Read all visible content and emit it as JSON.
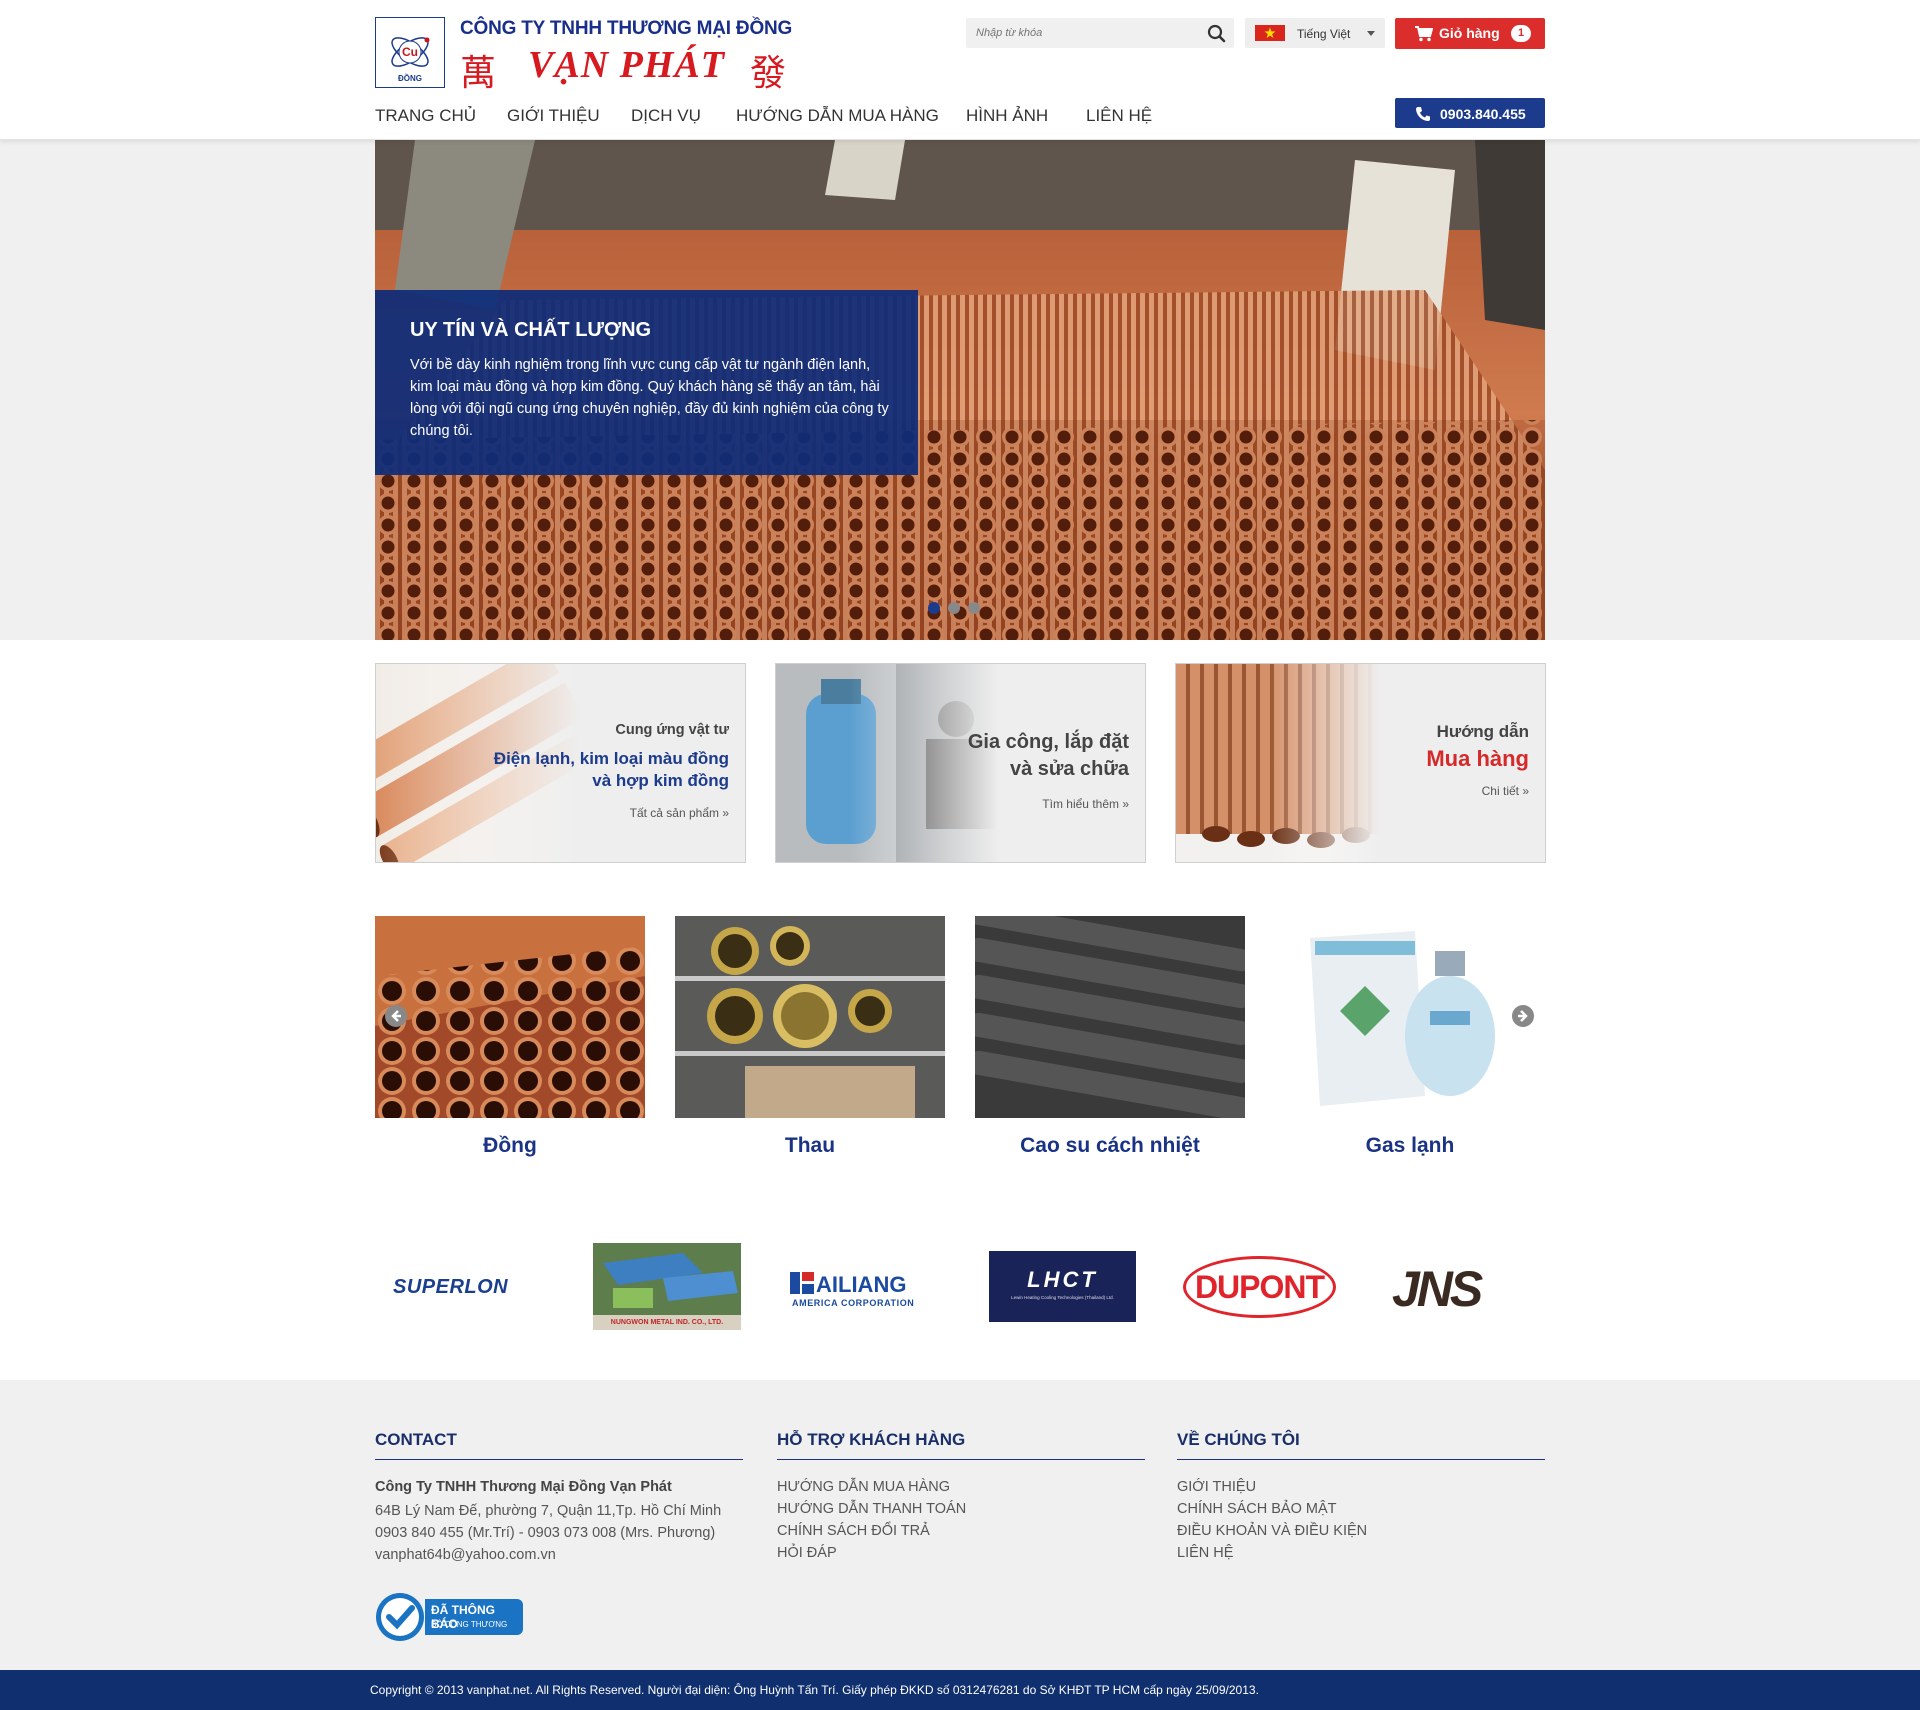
{
  "header": {
    "logo_cu": "Cu",
    "logo_dong": "ĐỒNG",
    "company_line1": "CÔNG TY TNHH THƯƠNG MẠI ĐỒNG",
    "company_name": "VẠN PHÁT",
    "han_left": "萬",
    "han_right": "發",
    "search_placeholder": "Nhập từ khóa",
    "language": "Tiếng Việt",
    "cart_label": "Giỏ hàng",
    "cart_count": "1",
    "hotline": "0903.840.455"
  },
  "nav": {
    "items": [
      "TRANG CHỦ",
      "GIỚI THIỆU",
      "DỊCH VỤ",
      "HƯỚNG DẪN MUA HÀNG",
      "HÌNH ẢNH",
      "LIÊN HỆ"
    ]
  },
  "hero": {
    "title": "UY TÍN VÀ CHẤT LƯỢNG",
    "description": "Với bề dày kinh nghiệm trong lĩnh vực cung cấp vật tư ngành điện lạnh, kim loại màu đồng và hợp kim đồng. Quý khách hàng sẽ thấy an tâm, hài lòng với đội ngũ cung ứng chuyên nghiệp, đầy đủ kinh nghiệm của công ty chúng tôi.",
    "slide_count": 3,
    "active_slide": 1
  },
  "features": [
    {
      "line1": "Cung ứng vật tư",
      "line2": "Điện lạnh,  kim loại màu đồng",
      "line3": "và hợp kim đồng",
      "link": "Tất cả sản phẩm »"
    },
    {
      "line1": "Gia công, lắp đặt",
      "line2": "và sửa chữa",
      "link": "Tìm hiểu thêm »"
    },
    {
      "line1": "Hướng dẫn",
      "line2": "Mua hàng",
      "link": "Chi tiết »"
    }
  ],
  "products": [
    "Đồng",
    "Thau",
    "Cao su cách nhiệt",
    "Gas lạnh"
  ],
  "partners": {
    "superlon": "SUPERLON",
    "nungwon": "NUNGWON METAL IND. CO., LTD.",
    "hailiang": "AILIANG",
    "hailiang_sub": "AMERICA CORPORATION",
    "lhct": "LHCT",
    "lhct_sub": "Lewin Heating Cooling Technologies (Thailand) Ltd.",
    "dupont": "DUPONT",
    "jns": "JNS"
  },
  "footer": {
    "contact": {
      "heading": "CONTACT",
      "company": "Công Ty TNHH Thương Mại Đồng Vạn Phát",
      "address": "64B Lý Nam Đế, phường 7, Quận 11,Tp. Hồ Chí Minh",
      "phones": "0903 840 455 (Mr.Trí) - 0903 073 008 (Mrs. Phương)",
      "email": "vanphat64b@yahoo.com.vn",
      "badge_title": "ĐÃ THÔNG BÁO",
      "badge_sub": "BỘ CÔNG THƯƠNG"
    },
    "support": {
      "heading": "HỖ TRỢ KHÁCH HÀNG",
      "links": [
        "HƯỚNG DẪN MUA HÀNG",
        "HƯỚNG DẪN THANH TOÁN",
        "CHÍNH SÁCH ĐỔI TRẢ",
        "HỎI ĐÁP"
      ]
    },
    "about": {
      "heading": "VỀ CHÚNG TÔI",
      "links": [
        "GIỚI THIỆU",
        "CHÍNH SÁCH BẢO MẬT",
        "ĐIỀU KHOẢN VÀ ĐIỀU KIỆN",
        "LIÊN HỆ"
      ]
    },
    "copyright": "Copyright © 2013 vanphat.net. All Rights Reserved. Người đại diện: Ông Huỳnh Tấn Trí. Giấy phép ĐKKD số 0312476281 do Sở KHĐT TP HCM cấp ngày 25/09/2013."
  },
  "colors": {
    "brand_blue": "#1c3b8c",
    "brand_red": "#d71920",
    "cart_red": "#dc2d2d",
    "footer_bar": "#102f6e"
  }
}
